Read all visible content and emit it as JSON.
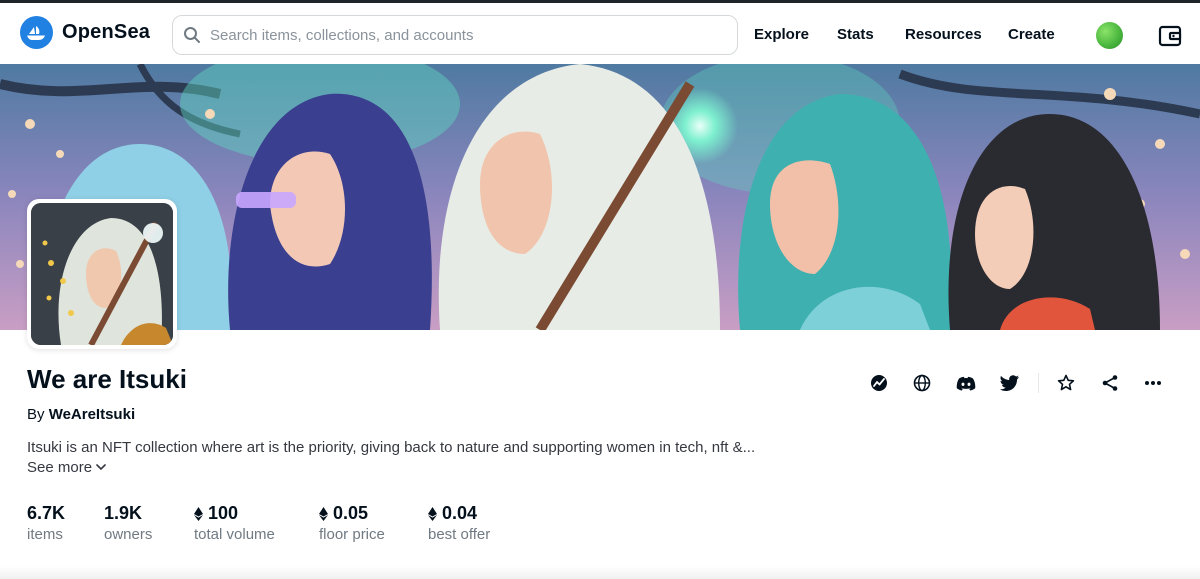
{
  "navbar": {
    "brand": "OpenSea",
    "search_placeholder": "Search items, collections, and accounts",
    "links": {
      "explore": "Explore",
      "stats": "Stats",
      "resources": "Resources",
      "create": "Create"
    },
    "icons": [
      "opensea-logo-icon",
      "search-icon",
      "profile-avatar",
      "wallet-icon"
    ]
  },
  "collection": {
    "title": "We are Itsuki",
    "by_prefix": "By",
    "creator": "WeAreItsuki",
    "description": "Itsuki is an NFT collection where art is the priority, giving back to nature and supporting women in tech, nft &...",
    "see_more": "See more"
  },
  "stats": [
    {
      "value": "6.7K",
      "label": "items",
      "eth": false
    },
    {
      "value": "1.9K",
      "label": "owners",
      "eth": false
    },
    {
      "value": "100",
      "label": "total volume",
      "eth": true
    },
    {
      "value": "0.05",
      "label": "floor price",
      "eth": true
    },
    {
      "value": "0.04",
      "label": "best offer",
      "eth": true
    }
  ],
  "actions": [
    "activity-icon",
    "website-icon",
    "discord-icon",
    "twitter-icon",
    "star-icon",
    "share-icon",
    "more-icon"
  ],
  "colors": {
    "brand_blue": "#2081e2",
    "text_primary": "#04111d",
    "text_secondary": "#707a83",
    "border": "#d6d9dc"
  }
}
